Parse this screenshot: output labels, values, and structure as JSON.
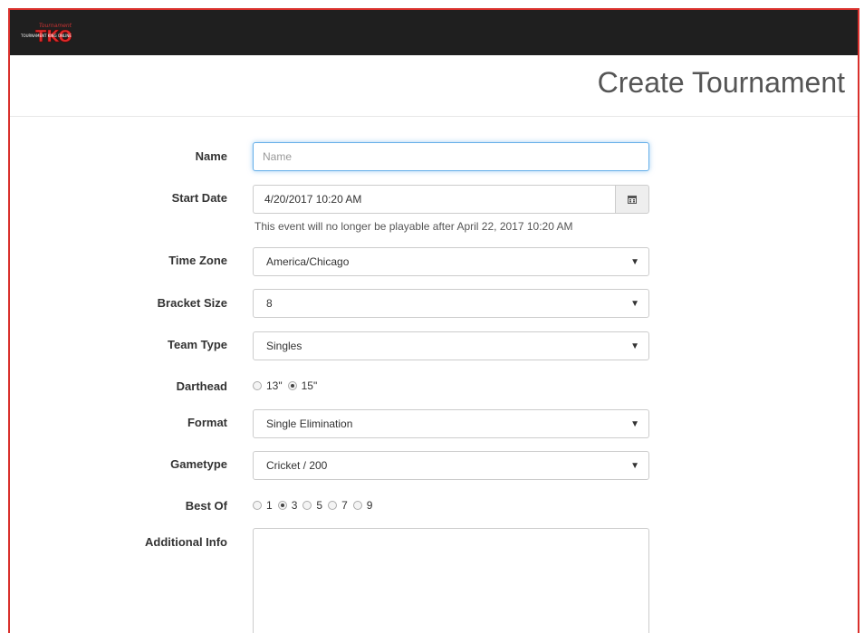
{
  "header": {
    "title": "Create Tournament"
  },
  "logo": {
    "text": "TKO",
    "subtitle": "TOURNAMENT KING ONLINE"
  },
  "form": {
    "name": {
      "label": "Name",
      "placeholder": "Name",
      "value": ""
    },
    "start_date": {
      "label": "Start Date",
      "value": "4/20/2017 10:20 AM",
      "help": "This event will no longer be playable after April 22, 2017 10:20 AM",
      "icon": "calendar-icon"
    },
    "time_zone": {
      "label": "Time Zone",
      "value": "America/Chicago"
    },
    "bracket_size": {
      "label": "Bracket Size",
      "value": "8"
    },
    "team_type": {
      "label": "Team Type",
      "value": "Singles"
    },
    "darthead": {
      "label": "Darthead",
      "options": [
        "13\"",
        "15\""
      ],
      "selected": "15\""
    },
    "format": {
      "label": "Format",
      "value": "Single Elimination"
    },
    "gametype": {
      "label": "Gametype",
      "value": "Cricket / 200"
    },
    "best_of": {
      "label": "Best Of",
      "options": [
        "1",
        "3",
        "5",
        "7",
        "9"
      ],
      "selected": "3"
    },
    "additional_info": {
      "label": "Additional Info",
      "value": ""
    }
  },
  "colors": {
    "accent_border": "#d9302c",
    "topbar": "#1f1f1f",
    "focus": "#66afe9"
  }
}
